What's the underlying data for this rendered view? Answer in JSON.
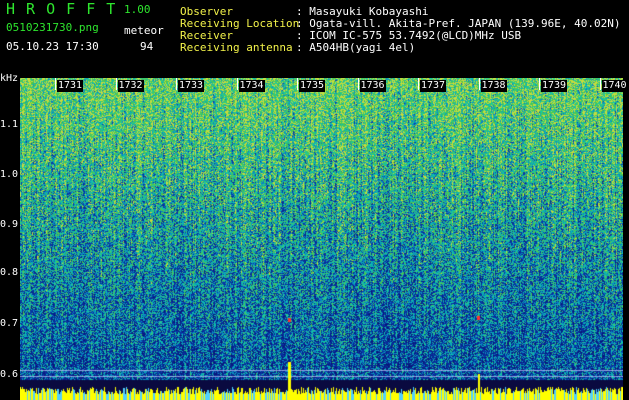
{
  "app": {
    "title": "H R O F F T",
    "version": "1.00",
    "filename": "0510231730.png",
    "datetime": "05.10.23 17:30",
    "meteor_label": "meteor",
    "meteor_count": "94"
  },
  "info": {
    "observer_key": "Observer",
    "observer_val": ": Masayuki Kobayashi",
    "location_key": "Receiving Location",
    "location_val": ": Ogata-vill. Akita-Pref. JAPAN (139.96E, 40.02N)",
    "receiver_key": "Receiver",
    "receiver_val": ": ICOM IC-575 53.7492(@LCD)MHz USB",
    "antenna_key": "Receiving antenna",
    "antenna_val": ": A504HB(yagi 4el)"
  },
  "axis": {
    "unit": "kHz",
    "y_ticks": [
      "1.1",
      "1.0",
      "0.9",
      "0.8",
      "0.7",
      "0.6"
    ],
    "x_ticks": [
      "1731",
      "1732",
      "1733",
      "1734",
      "1735",
      "1736",
      "1737",
      "1738",
      "1739",
      "1740"
    ]
  },
  "colors": {
    "background": "#000000",
    "title_green": "#2ee62e",
    "label_yellow": "#f2f24a",
    "spectrum_low": "#0b1a8a",
    "spectrum_mid": "#1fa3c8",
    "spectrum_high": "#3fd25a",
    "signal_peak": "#ffff00"
  }
}
